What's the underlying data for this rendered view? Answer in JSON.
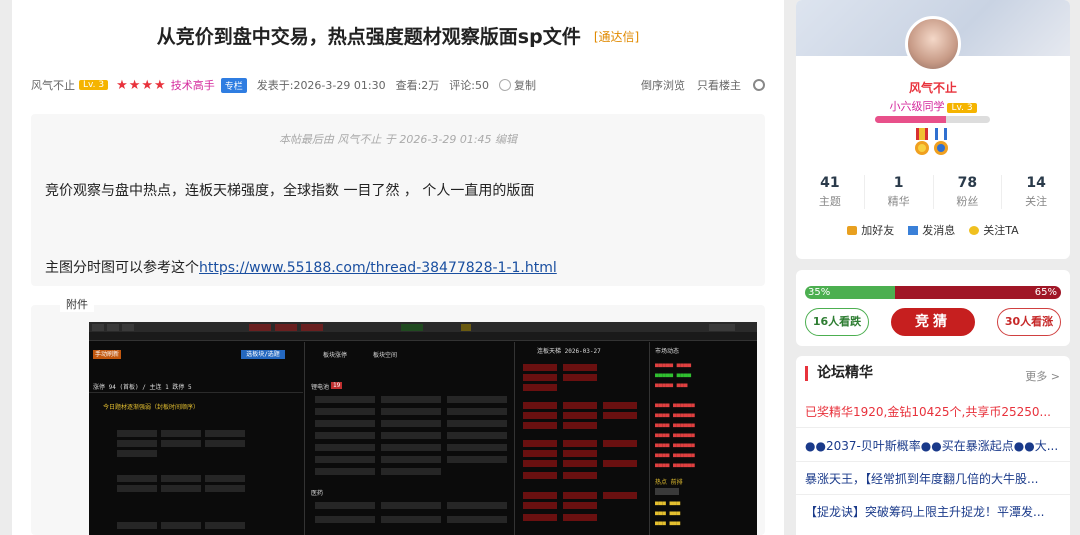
{
  "thread": {
    "title": "从竞价到盘中交易，热点强度题材观察版面sp文件",
    "tag": "[通达信]"
  },
  "meta": {
    "author": "风气不止",
    "level": "Lv. 3",
    "stars": "★★★★",
    "expert": "技术高手",
    "column": "专栏",
    "posted": "发表于:2026-3-29 01:30",
    "views": "查看:2万",
    "comments": "评论:50",
    "copy": "复制",
    "reverse": "倒序浏览",
    "only_op": "只看楼主"
  },
  "post": {
    "edited": "本帖最后由 风气不止 于 2026-3-29 01:45 编辑",
    "para1": "竞价观察与盘中热点，连板天梯强度，全球指数   一目了然  ，  个人一直用的版面",
    "para2_prefix": "主图分时图可以参考这个",
    "link": "https://www.55188.com/thread-38477828-1-1.html",
    "attachment_label": "附件"
  },
  "screenshot": {
    "btn_pos": "手动刷新",
    "btn_blue": "选板块/选题",
    "row_count": "涨停 94 (首板) / 主连 1 跌停 5",
    "theme1": "今日题材逐渐强弱（封板时间顺序）",
    "tab1": "板块涨停",
    "tab2": "板块空间",
    "sector1": "锂电池",
    "sector2": "医药",
    "panel_title": "连板天梯 2026-03-27",
    "market": "市场动态",
    "hot": "热点 前排"
  },
  "profile": {
    "name": "风气不止",
    "rank": "小六级同学",
    "level": "Lv. 3",
    "level_progress": 0.62,
    "stats": [
      {
        "n": "41",
        "l": "主题"
      },
      {
        "n": "1",
        "l": "精华"
      },
      {
        "n": "78",
        "l": "粉丝"
      },
      {
        "n": "14",
        "l": "关注"
      }
    ],
    "actions": {
      "add": "加好友",
      "msg": "发消息",
      "follow": "关注TA"
    }
  },
  "vote": {
    "bull_pct": "35%",
    "bear_pct": "65%",
    "bull_fraction": 0.35,
    "bull": "16人看跌",
    "guess": "竞猜",
    "bear": "30人看涨"
  },
  "forum": {
    "title": "论坛精华",
    "more": "更多 >",
    "items": [
      "已奖精华1920,金钻10425个,共享币25250...",
      "●●2037-贝叶斯概率●●买在暴涨起点●●大...",
      "暴涨天王，【经常抓到年度翻几倍的大牛股...",
      "【捉龙诀】突破筹码上限主升捉龙！平潭发..."
    ]
  },
  "colors": {
    "accent_red": "#e8323c",
    "brand_blue": "#2f7de1",
    "lv_gold": "#f5b400"
  }
}
